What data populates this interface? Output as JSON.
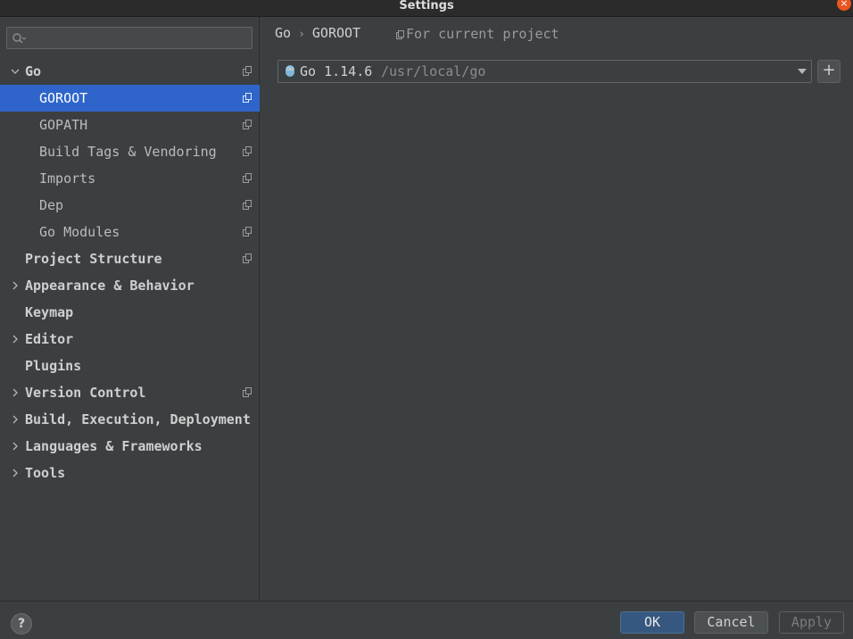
{
  "window": {
    "title": "Settings",
    "close_glyph": "×"
  },
  "search": {
    "placeholder": "",
    "value": ""
  },
  "sidebar": {
    "items": [
      {
        "label": "Go",
        "bold": true,
        "expanded": true,
        "has_copy_icon": true
      },
      {
        "label": "GOROOT",
        "selected": true,
        "has_copy_icon": true
      },
      {
        "label": "GOPATH",
        "has_copy_icon": true
      },
      {
        "label": "Build Tags & Vendoring",
        "has_copy_icon": true
      },
      {
        "label": "Imports",
        "has_copy_icon": true
      },
      {
        "label": "Dep",
        "has_copy_icon": true
      },
      {
        "label": "Go Modules",
        "has_copy_icon": true
      },
      {
        "label": "Project Structure",
        "bold": true,
        "has_copy_icon": true
      },
      {
        "label": "Appearance & Behavior",
        "bold": true,
        "expandable": true
      },
      {
        "label": "Keymap",
        "bold": true
      },
      {
        "label": "Editor",
        "bold": true,
        "expandable": true
      },
      {
        "label": "Plugins",
        "bold": true
      },
      {
        "label": "Version Control",
        "bold": true,
        "expandable": true,
        "has_copy_icon": true
      },
      {
        "label": "Build, Execution, Deployment",
        "bold": true,
        "expandable": true
      },
      {
        "label": "Languages & Frameworks",
        "bold": true,
        "expandable": true
      },
      {
        "label": "Tools",
        "bold": true,
        "expandable": true
      }
    ]
  },
  "main": {
    "breadcrumb": {
      "parent": "Go",
      "separator": "›",
      "current": "GOROOT"
    },
    "scope_label": "For current project",
    "sdk": {
      "name": "Go 1.14.6",
      "path": "/usr/local/go"
    },
    "add_glyph": "+"
  },
  "footer": {
    "help_glyph": "?",
    "ok_label": "OK",
    "cancel_label": "Cancel",
    "apply_label": "Apply"
  },
  "colors": {
    "background": "#3c3f41",
    "selection": "#2f65ca",
    "close_button": "#e95420",
    "ok_button": "#365880"
  }
}
